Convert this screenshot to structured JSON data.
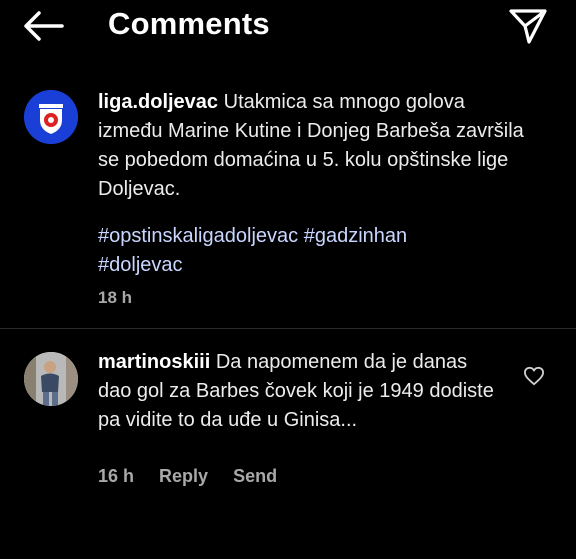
{
  "header": {
    "title": "Comments",
    "back_icon": "arrow-left-icon",
    "send_icon": "paper-plane-icon"
  },
  "post": {
    "username": "liga.doljevac",
    "text": "Utakmica sa mnogo golova između Marine Kutine i Donjeg Barbeša završila se pobedom domaćina u 5. kolu opštinske lige Doljevac.",
    "hashtags": [
      "#opstinskaligadoljevac",
      "#gadzinhan",
      "#doljevac"
    ],
    "time": "18 h",
    "avatar_color": "#1a3fd6"
  },
  "comment": {
    "username": "martinoskiii",
    "text": "Da napomenem da je danas dao gol za Barbes čovek koji je 1949 dodiste pa vidite to da uđe u Ginisa...",
    "time": "16 h",
    "reply_label": "Reply",
    "send_label": "Send",
    "like_icon": "heart-outline-icon"
  }
}
